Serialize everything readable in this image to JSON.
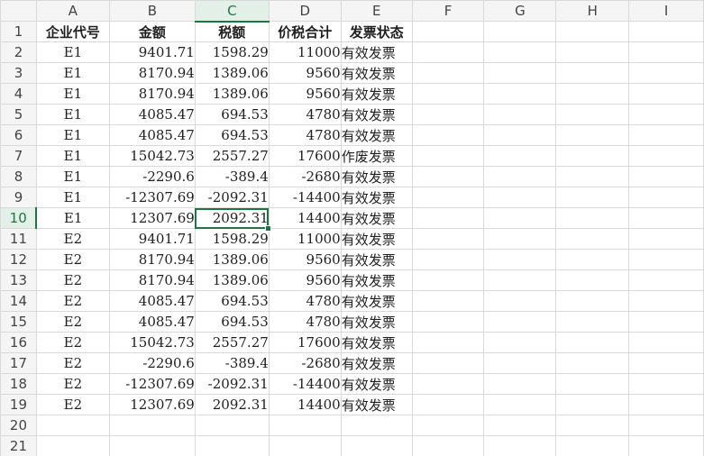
{
  "columns": [
    "A",
    "B",
    "C",
    "D",
    "E",
    "F",
    "G",
    "H",
    "I"
  ],
  "selected_column": "C",
  "selected_row": "10",
  "header_row": {
    "row_num": "1",
    "cells": [
      "企业代号",
      "金额",
      "税额",
      "价税合计",
      "发票状态"
    ]
  },
  "rows": [
    {
      "row_num": "2",
      "cells": [
        "E1",
        "9401.71",
        "1598.29",
        "11000",
        "有效发票"
      ]
    },
    {
      "row_num": "3",
      "cells": [
        "E1",
        "8170.94",
        "1389.06",
        "9560",
        "有效发票"
      ]
    },
    {
      "row_num": "4",
      "cells": [
        "E1",
        "8170.94",
        "1389.06",
        "9560",
        "有效发票"
      ]
    },
    {
      "row_num": "5",
      "cells": [
        "E1",
        "4085.47",
        "694.53",
        "4780",
        "有效发票"
      ]
    },
    {
      "row_num": "6",
      "cells": [
        "E1",
        "4085.47",
        "694.53",
        "4780",
        "有效发票"
      ]
    },
    {
      "row_num": "7",
      "cells": [
        "E1",
        "15042.73",
        "2557.27",
        "17600",
        "作废发票"
      ]
    },
    {
      "row_num": "8",
      "cells": [
        "E1",
        "-2290.6",
        "-389.4",
        "-2680",
        "有效发票"
      ]
    },
    {
      "row_num": "9",
      "cells": [
        "E1",
        "-12307.69",
        "-2092.31",
        "-14400",
        "有效发票"
      ]
    },
    {
      "row_num": "10",
      "cells": [
        "E1",
        "12307.69",
        "2092.31",
        "14400",
        "有效发票"
      ]
    },
    {
      "row_num": "11",
      "cells": [
        "E2",
        "9401.71",
        "1598.29",
        "11000",
        "有效发票"
      ]
    },
    {
      "row_num": "12",
      "cells": [
        "E2",
        "8170.94",
        "1389.06",
        "9560",
        "有效发票"
      ]
    },
    {
      "row_num": "13",
      "cells": [
        "E2",
        "8170.94",
        "1389.06",
        "9560",
        "有效发票"
      ]
    },
    {
      "row_num": "14",
      "cells": [
        "E2",
        "4085.47",
        "694.53",
        "4780",
        "有效发票"
      ]
    },
    {
      "row_num": "15",
      "cells": [
        "E2",
        "4085.47",
        "694.53",
        "4780",
        "有效发票"
      ]
    },
    {
      "row_num": "16",
      "cells": [
        "E2",
        "15042.73",
        "2557.27",
        "17600",
        "有效发票"
      ]
    },
    {
      "row_num": "17",
      "cells": [
        "E2",
        "-2290.6",
        "-389.4",
        "-2680",
        "有效发票"
      ]
    },
    {
      "row_num": "18",
      "cells": [
        "E2",
        "-12307.69",
        "-2092.31",
        "-14400",
        "有效发票"
      ]
    },
    {
      "row_num": "19",
      "cells": [
        "E2",
        "12307.69",
        "2092.31",
        "14400",
        "有效发票"
      ]
    }
  ],
  "empty_rows": [
    "20",
    "21"
  ],
  "colors": {
    "accent": "#217346",
    "grid": "#d9d9d9",
    "header_bg": "#f5f5f5"
  }
}
